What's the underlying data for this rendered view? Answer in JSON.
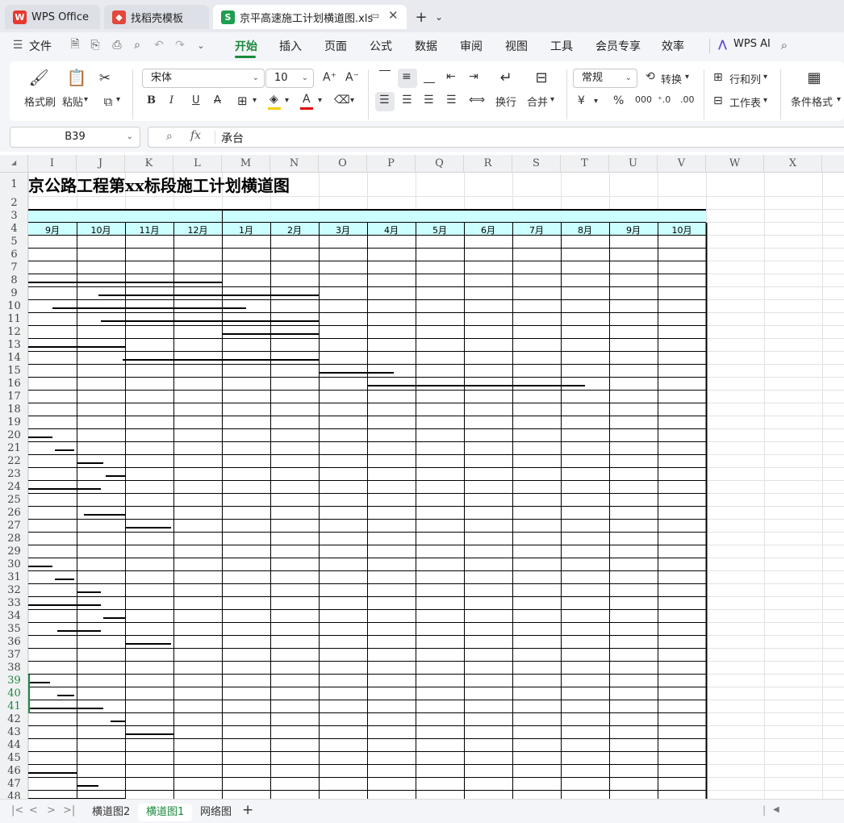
{
  "tabs": [
    {
      "label": "WPS Office",
      "active": false
    },
    {
      "label": "找稻壳模板",
      "active": false
    },
    {
      "label": "京平高速施工计划横道图.xls",
      "active": true
    }
  ],
  "menu": [
    "文件",
    "开始",
    "插入",
    "页面",
    "公式",
    "数据",
    "审阅",
    "视图",
    "工具",
    "会员专享",
    "效率"
  ],
  "active_menu": "开始",
  "wps_ai": "WPS AI",
  "ribbon": {
    "format_painter": "格式刷",
    "paste": "粘贴",
    "font_name": "宋体",
    "font_size": "10",
    "wrap": "换行",
    "merge": "合并",
    "number_format": "常规",
    "convert": "转换",
    "row_col": "行和列",
    "worksheet": "工作表",
    "cond_format": "条件格式",
    "bold": "B",
    "italic": "I",
    "underline": "U",
    "strike": "A"
  },
  "formula_bar": {
    "name_box": "B39",
    "fx": "fx",
    "content": "承台"
  },
  "columns": [
    "I",
    "J",
    "K",
    "L",
    "M",
    "N",
    "O",
    "P",
    "Q",
    "R",
    "S",
    "T",
    "U",
    "V",
    "W",
    "X"
  ],
  "title": "京公路工程第xx标段施工计划横道图",
  "months": [
    "9月",
    "10月",
    "11月",
    "12月",
    "1月",
    "2月",
    "3月",
    "4月",
    "5月",
    "6月",
    "7月",
    "8月",
    "9月",
    "10月"
  ],
  "rows": [
    1,
    2,
    3,
    4,
    5,
    6,
    7,
    8,
    9,
    10,
    11,
    12,
    13,
    14,
    15,
    16,
    17,
    18,
    19,
    20,
    21,
    22,
    23,
    24,
    25,
    26,
    27,
    28,
    29,
    30,
    31,
    32,
    33,
    34,
    35,
    36,
    37,
    38,
    39,
    40,
    41,
    42,
    43,
    44,
    45,
    46,
    47,
    48
  ],
  "selected_rows": [
    39,
    40,
    41
  ],
  "gantt_bars": [
    {
      "row": 8,
      "start": 0.0,
      "end": 4.0
    },
    {
      "row": 9,
      "start": 1.45,
      "end": 6.0
    },
    {
      "row": 10,
      "start": 0.5,
      "end": 4.5
    },
    {
      "row": 11,
      "start": 1.5,
      "end": 6.0
    },
    {
      "row": 12,
      "start": 4.0,
      "end": 6.0
    },
    {
      "row": 13,
      "start": 0.0,
      "end": 2.0
    },
    {
      "row": 14,
      "start": 1.95,
      "end": 6.0
    },
    {
      "row": 15,
      "start": 6.0,
      "end": 7.55
    },
    {
      "row": 16,
      "start": 7.0,
      "end": 11.5
    },
    {
      "row": 20,
      "start": 0.0,
      "end": 0.5
    },
    {
      "row": 21,
      "start": 0.55,
      "end": 0.95
    },
    {
      "row": 22,
      "start": 1.0,
      "end": 1.55
    },
    {
      "row": 23,
      "start": 1.6,
      "end": 2.0
    },
    {
      "row": 24,
      "start": 0.0,
      "end": 1.5
    },
    {
      "row": 26,
      "start": 1.15,
      "end": 2.0
    },
    {
      "row": 27,
      "start": 2.0,
      "end": 2.95
    },
    {
      "row": 30,
      "start": 0.0,
      "end": 0.5
    },
    {
      "row": 31,
      "start": 0.55,
      "end": 0.95
    },
    {
      "row": 32,
      "start": 1.0,
      "end": 1.5
    },
    {
      "row": 33,
      "start": 0.0,
      "end": 1.5
    },
    {
      "row": 34,
      "start": 1.55,
      "end": 2.0
    },
    {
      "row": 35,
      "start": 0.6,
      "end": 1.5
    },
    {
      "row": 36,
      "start": 2.0,
      "end": 2.95
    },
    {
      "row": 39,
      "start": 0.0,
      "end": 0.45
    },
    {
      "row": 40,
      "start": 0.6,
      "end": 0.95
    },
    {
      "row": 41,
      "start": 0.0,
      "end": 1.55
    },
    {
      "row": 42,
      "start": 1.7,
      "end": 2.0
    },
    {
      "row": 43,
      "start": 2.0,
      "end": 3.0
    },
    {
      "row": 46,
      "start": 0.0,
      "end": 1.0
    },
    {
      "row": 47,
      "start": 1.0,
      "end": 1.45
    },
    {
      "row": 48,
      "start": 0.0,
      "end": 2.0
    }
  ],
  "sheets": [
    {
      "label": "横道图2",
      "active": false
    },
    {
      "label": "横道图1",
      "active": true
    },
    {
      "label": "网络图",
      "active": false
    }
  ],
  "colors": {
    "accent": "#1b8a3e",
    "header_fill": "#ccffff",
    "chrome": "#f4f5f8"
  }
}
